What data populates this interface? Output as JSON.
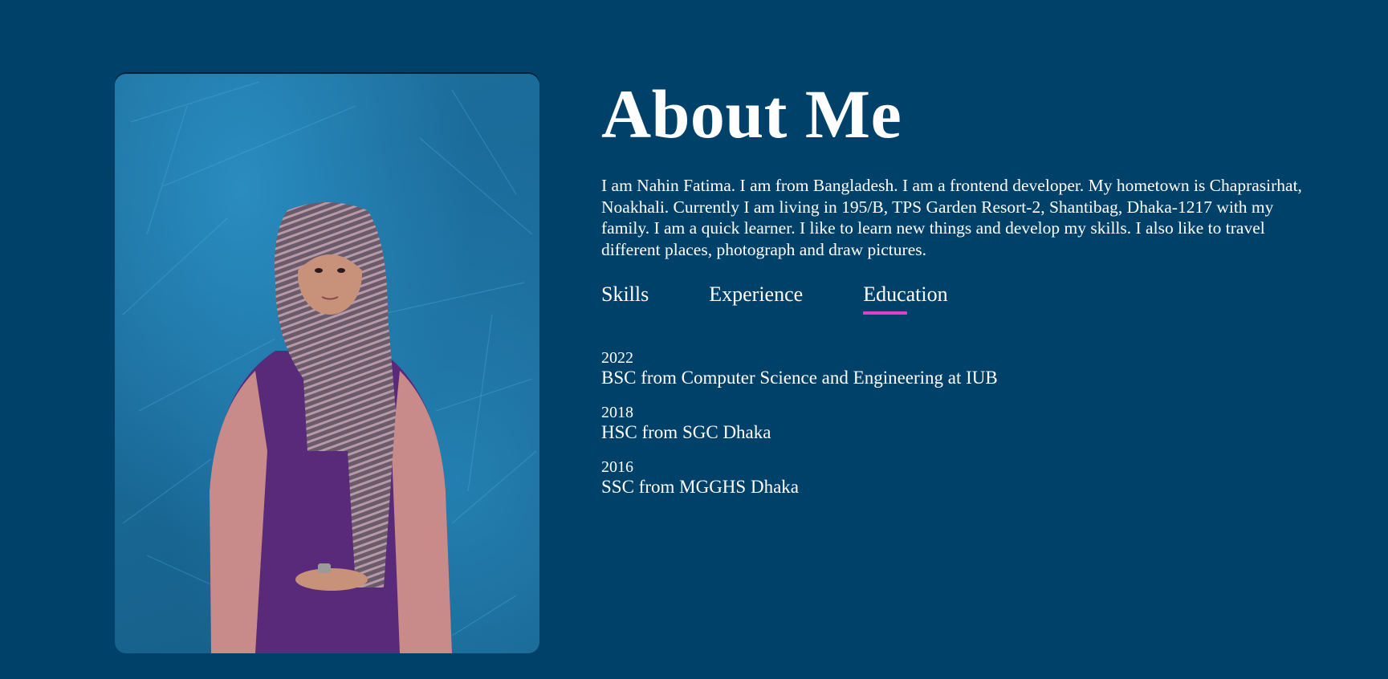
{
  "about": {
    "title": "About Me",
    "bio": "I am Nahin Fatima. I am from Bangladesh. I am a frontend developer. My hometown is Chaprasirhat, Noakhali. Currently I am living in 195/B, TPS Garden Resort-2, Shantibag, Dhaka-1217 with my family. I am a quick learner. I like to learn new things and develop my skills. I also like to travel different places, photograph and draw pictures."
  },
  "tabs": [
    {
      "label": "Skills",
      "active": false
    },
    {
      "label": "Experience",
      "active": false
    },
    {
      "label": "Education",
      "active": true
    }
  ],
  "education": [
    {
      "year": "2022",
      "desc": "BSC from Computer Science and Engineering at IUB"
    },
    {
      "year": "2018",
      "desc": "HSC from SGC Dhaka"
    },
    {
      "year": "2016",
      "desc": "SSC from MGGHS Dhaka"
    }
  ],
  "colors": {
    "background": "#00416a",
    "accent": "#e040c8",
    "text": "#ffffff"
  }
}
